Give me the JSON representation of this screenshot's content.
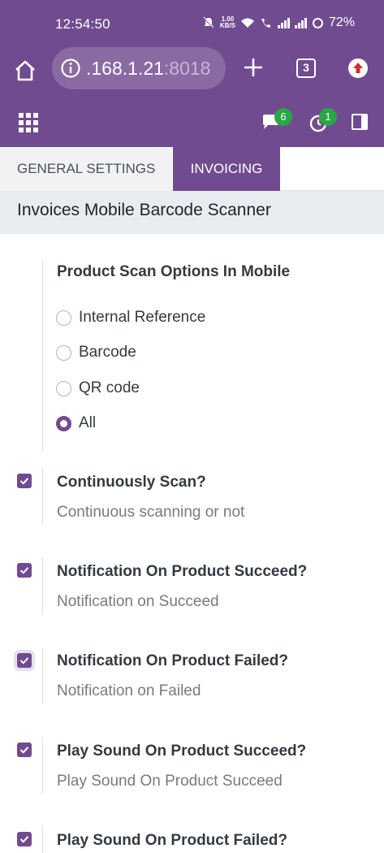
{
  "status_bar": {
    "time": "12:54:50",
    "net_speed_value": "1.00",
    "net_speed_unit": "KB/S",
    "battery": "72%"
  },
  "browser": {
    "url_main": ".168.1.21",
    "url_port": ":8018",
    "tab_count": "3"
  },
  "navbar": {
    "messages_count": "6",
    "activities_count": "1"
  },
  "tabs": [
    {
      "label": "GENERAL SETTINGS",
      "active": false
    },
    {
      "label": "INVOICING",
      "active": true
    }
  ],
  "section": {
    "title": "Invoices Mobile Barcode Scanner"
  },
  "scan_options": {
    "title": "Product Scan Options In Mobile",
    "options": [
      {
        "label": "Internal Reference",
        "selected": false
      },
      {
        "label": "Barcode",
        "selected": false
      },
      {
        "label": "QR code",
        "selected": false
      },
      {
        "label": "All",
        "selected": true
      }
    ]
  },
  "settings": [
    {
      "title": "Continuously Scan?",
      "description": "Continuous scanning or not",
      "checked": true
    },
    {
      "title": "Notification On Product Succeed?",
      "description": "Notification on Succeed",
      "checked": true
    },
    {
      "title": "Notification On Product Failed?",
      "description": "Notification on Failed",
      "checked": true
    },
    {
      "title": "Play Sound On Product Succeed?",
      "description": "Play Sound On Product Succeed",
      "checked": true
    },
    {
      "title": "Play Sound On Product Failed?",
      "description": "",
      "checked": true
    }
  ],
  "colors": {
    "brand": "#714b8f",
    "badge": "#28a745"
  }
}
